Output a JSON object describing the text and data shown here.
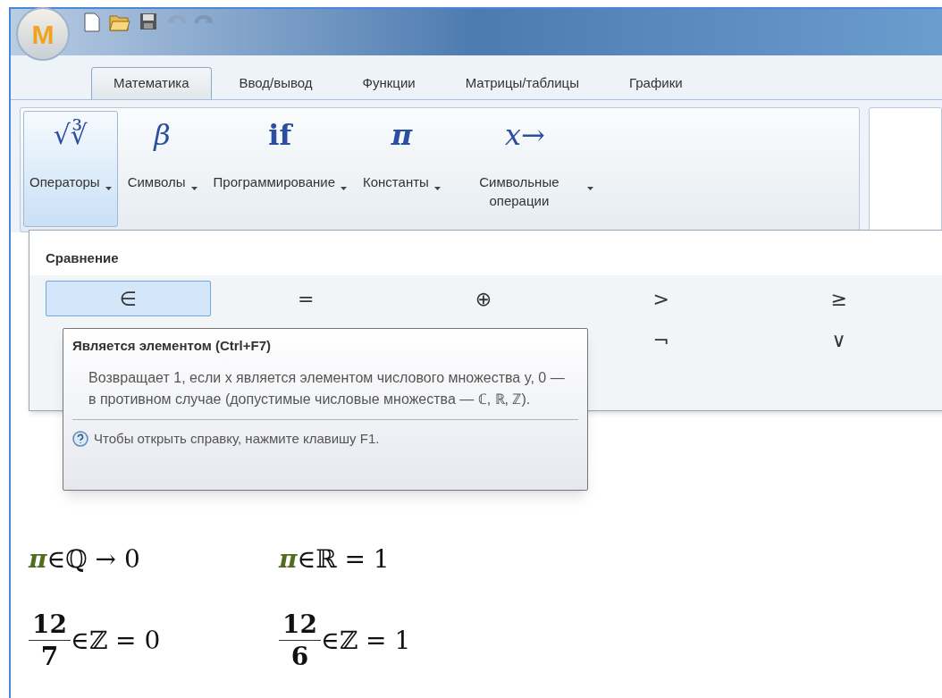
{
  "app_button": {
    "label": "M"
  },
  "tabs": [
    {
      "label": "Математика",
      "selected": true
    },
    {
      "label": "Ввод/вывод",
      "selected": false
    },
    {
      "label": "Функции",
      "selected": false
    },
    {
      "label": "Матрицы/таблицы",
      "selected": false
    },
    {
      "label": "Графики",
      "selected": false
    }
  ],
  "ribbon_buttons": [
    {
      "icon": "√∛",
      "kind": "root",
      "label": "Операторы",
      "selected": true
    },
    {
      "icon": "β",
      "kind": "italic",
      "label": "Символы",
      "selected": false
    },
    {
      "icon": "if",
      "kind": "bold",
      "label": "Программирование",
      "selected": false
    },
    {
      "icon": "π",
      "kind": "bolditalic",
      "label": "Константы",
      "selected": false
    },
    {
      "icon": "x→",
      "kind": "italic",
      "label": "Символьные операции",
      "selected": false
    }
  ],
  "panel": {
    "title": "Сравнение",
    "rows": [
      [
        {
          "symbol": "∈",
          "selected": true
        },
        {
          "symbol": "=",
          "selected": false
        },
        {
          "symbol": "⊕",
          "selected": false
        },
        {
          "symbol": ">",
          "selected": false
        },
        {
          "symbol": "≥",
          "selected": false
        }
      ],
      [
        null,
        null,
        null,
        {
          "symbol": "¬",
          "selected": false
        },
        {
          "symbol": "∨",
          "selected": false
        }
      ]
    ]
  },
  "tooltip": {
    "title": "Является элементом (Ctrl+F7)",
    "body": "Возвращает 1, если x является элементом числового множества y, 0 — в противном случае (допустимые числовые множества — ℂ, ℝ, ℤ).",
    "help": "Чтобы открыть справку, нажмите клавишу F1."
  },
  "worksheet": [
    [
      {
        "kind": "constant",
        "lead": "π",
        "rest": "∈ℚ → 0"
      },
      {
        "kind": "constant",
        "lead": "π",
        "rest": "∈ℝ = 1"
      }
    ],
    [
      {
        "kind": "fraction",
        "numerator": "12",
        "denominator": "7",
        "rest": "∈ℤ = 0"
      },
      {
        "kind": "fraction",
        "numerator": "12",
        "denominator": "6",
        "rest": "∈ℤ = 1"
      }
    ]
  ]
}
